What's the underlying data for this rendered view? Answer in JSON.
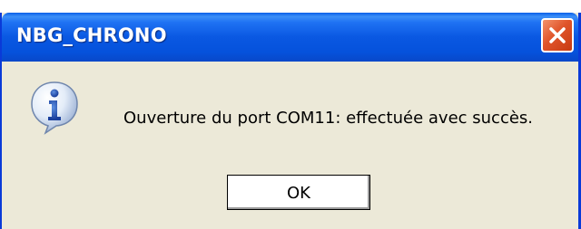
{
  "window": {
    "title": "NBG_CHRONO",
    "close_icon": "close-icon"
  },
  "dialog": {
    "icon": "info-icon",
    "message": "Ouverture du port COM11: effectuée avec succès.",
    "ok_label": "OK"
  },
  "colors": {
    "title_bar": "#0a58e2",
    "dialog_background": "#ece9d8",
    "close_button": "#e0542a"
  }
}
